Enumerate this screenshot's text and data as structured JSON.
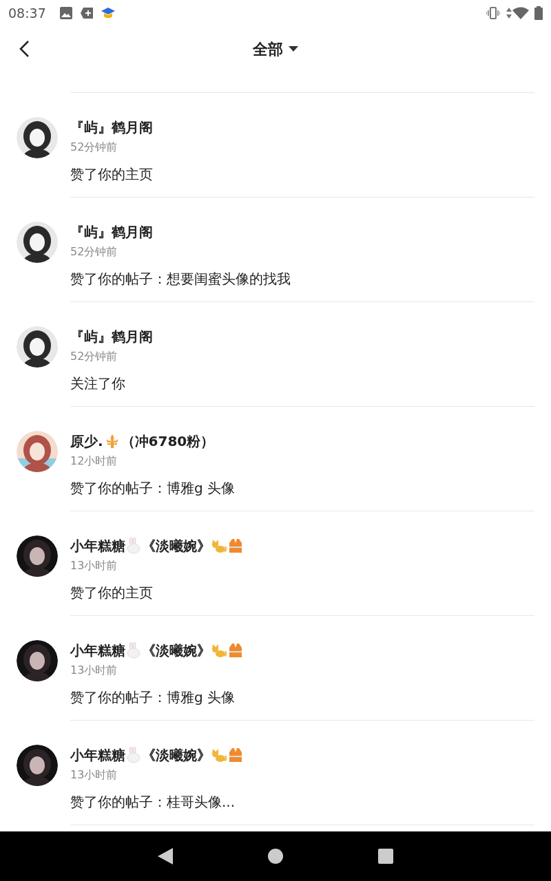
{
  "status_bar": {
    "time": "08:37"
  },
  "header": {
    "title": "全部"
  },
  "notifications": [
    {
      "kind": "mono",
      "name": [
        {
          "kind": "text",
          "text": "『屿』鹤月阁"
        }
      ],
      "time": "52分钟前",
      "message": "赞了你的主页"
    },
    {
      "kind": "mono",
      "name": [
        {
          "kind": "text",
          "text": "『屿』鹤月阁"
        }
      ],
      "time": "52分钟前",
      "message": "赞了你的帖子：想要闺蜜头像的找我"
    },
    {
      "kind": "mono",
      "name": [
        {
          "kind": "text",
          "text": "『屿』鹤月阁"
        }
      ],
      "time": "52分钟前",
      "message": "关注了你"
    },
    {
      "kind": "pastel",
      "name": [
        {
          "kind": "text",
          "text": "原少."
        },
        {
          "kind": "fleur"
        },
        {
          "kind": "text",
          "text": "（冲6780粉）"
        }
      ],
      "time": "12小时前",
      "message": "赞了你的帖子：博雅g 头像"
    },
    {
      "kind": "dark",
      "name": [
        {
          "kind": "text",
          "text": "小年糕糖"
        },
        {
          "kind": "rabbit"
        },
        {
          "kind": "text",
          "text": "《淡曦婉》"
        },
        {
          "kind": "cat"
        },
        {
          "kind": "vest"
        }
      ],
      "time": "13小时前",
      "message": "赞了你的主页"
    },
    {
      "kind": "dark",
      "name": [
        {
          "kind": "text",
          "text": "小年糕糖"
        },
        {
          "kind": "rabbit"
        },
        {
          "kind": "text",
          "text": "《淡曦婉》"
        },
        {
          "kind": "cat"
        },
        {
          "kind": "vest"
        }
      ],
      "time": "13小时前",
      "message": "赞了你的帖子：博雅g 头像"
    },
    {
      "kind": "dark",
      "name": [
        {
          "kind": "text",
          "text": "小年糕糖"
        },
        {
          "kind": "rabbit"
        },
        {
          "kind": "text",
          "text": "《淡曦婉》"
        },
        {
          "kind": "cat"
        },
        {
          "kind": "vest"
        }
      ],
      "time": "13小时前",
      "message": "赞了你的帖子：桂哥头像..."
    }
  ]
}
